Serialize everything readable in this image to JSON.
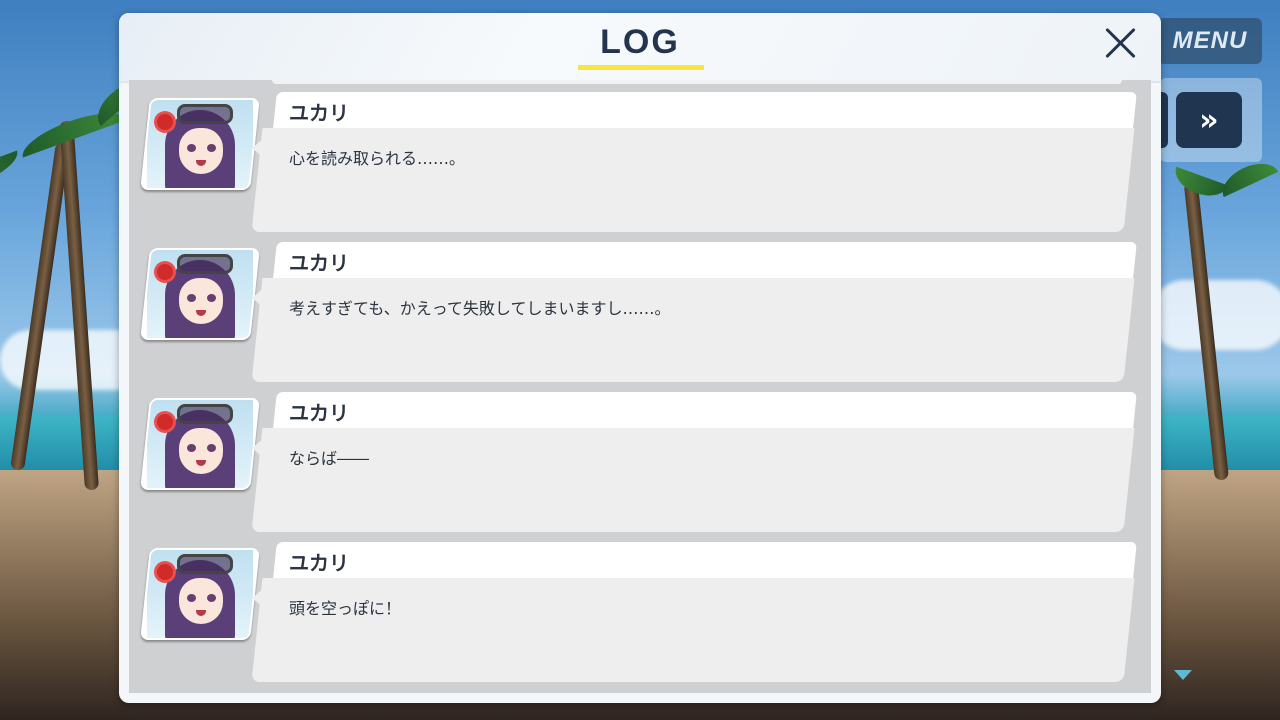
{
  "menu": {
    "label": "MENU",
    "skip_icon": "»"
  },
  "log": {
    "title": "LOG",
    "close_icon": "close-icon",
    "accent_color": "#f5e640",
    "title_color": "#23344d",
    "entries": [
      {
        "speaker": "ユカリ",
        "text": "心を読み取られる……。"
      },
      {
        "speaker": "ユカリ",
        "text": "考えすぎても、かえって失敗してしまいますし……。"
      },
      {
        "speaker": "ユカリ",
        "text": "ならば――"
      },
      {
        "speaker": "ユカリ",
        "text": "頭を空っぽに！"
      }
    ]
  }
}
